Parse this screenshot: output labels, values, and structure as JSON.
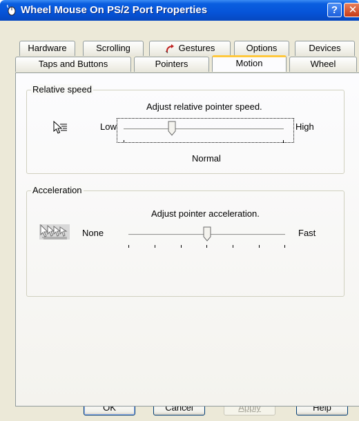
{
  "window": {
    "title": "Wheel Mouse On PS/2 Port Properties"
  },
  "tabs": {
    "row1": [
      "Hardware",
      "Scrolling",
      "Gestures",
      "Options",
      "Devices"
    ],
    "row2": [
      "Taps and Buttons",
      "Pointers",
      "Motion",
      "Wheel"
    ],
    "active": "Motion"
  },
  "relative_speed": {
    "group_label": "Relative speed",
    "caption": "Adjust relative pointer speed.",
    "low_label": "Low",
    "high_label": "High",
    "value_label": "Normal",
    "slider_value_fraction": 0.3
  },
  "acceleration": {
    "group_label": "Acceleration",
    "caption": "Adjust pointer acceleration.",
    "low_label": "None",
    "high_label": "Fast",
    "slider_value_fraction": 0.5
  },
  "buttons": {
    "ok": "OK",
    "cancel": "Cancel",
    "apply": "Apply",
    "help": "Help"
  },
  "icons": {
    "window": "mouse-icon",
    "gestures_tab": "gesture-arrow-icon",
    "speed": "pointer-speed-icon",
    "acceleration": "pointer-acceleration-icon"
  }
}
